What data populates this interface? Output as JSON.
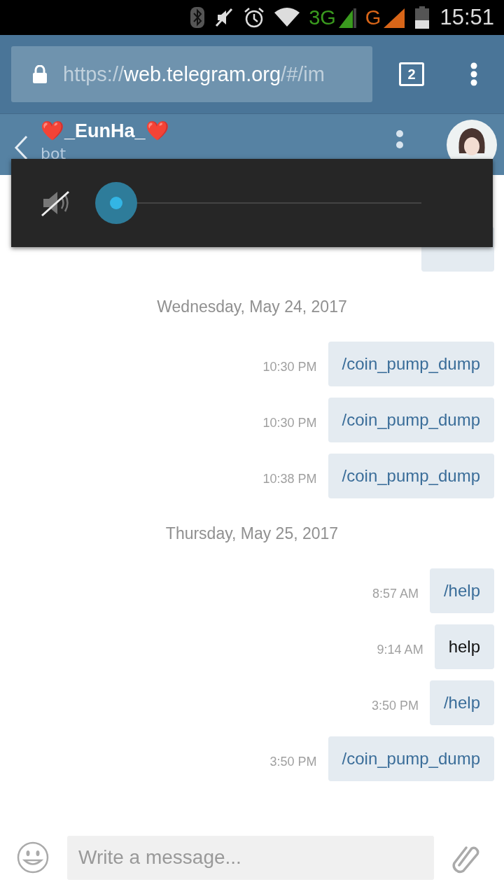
{
  "status_bar": {
    "network_1": "3G",
    "network_2": "G",
    "time": "15:51"
  },
  "browser": {
    "url_scheme": "https://",
    "url_host": "web.telegram.org",
    "url_path": "/#/im",
    "tab_count": "2"
  },
  "chat": {
    "title": "❤️_EunHa_❤️",
    "subtitle": "bot"
  },
  "volume_popup": {
    "muted": true
  },
  "messages": [
    {
      "kind": "date",
      "text": "Wednesday, May 24, 2017"
    },
    {
      "kind": "command",
      "time": "10:30 PM",
      "text": "/coin_pump_dump"
    },
    {
      "kind": "command",
      "time": "10:30 PM",
      "text": "/coin_pump_dump"
    },
    {
      "kind": "command",
      "time": "10:38 PM",
      "text": "/coin_pump_dump"
    },
    {
      "kind": "date",
      "text": "Thursday, May 25, 2017"
    },
    {
      "kind": "command",
      "time": "8:57 AM",
      "text": "/help"
    },
    {
      "kind": "text",
      "time": "9:14 AM",
      "text": "help"
    },
    {
      "kind": "command",
      "time": "3:50 PM",
      "text": "/help"
    },
    {
      "kind": "command",
      "time": "3:50 PM",
      "text": "/coin_pump_dump"
    }
  ],
  "composer": {
    "placeholder": "Write a message..."
  }
}
